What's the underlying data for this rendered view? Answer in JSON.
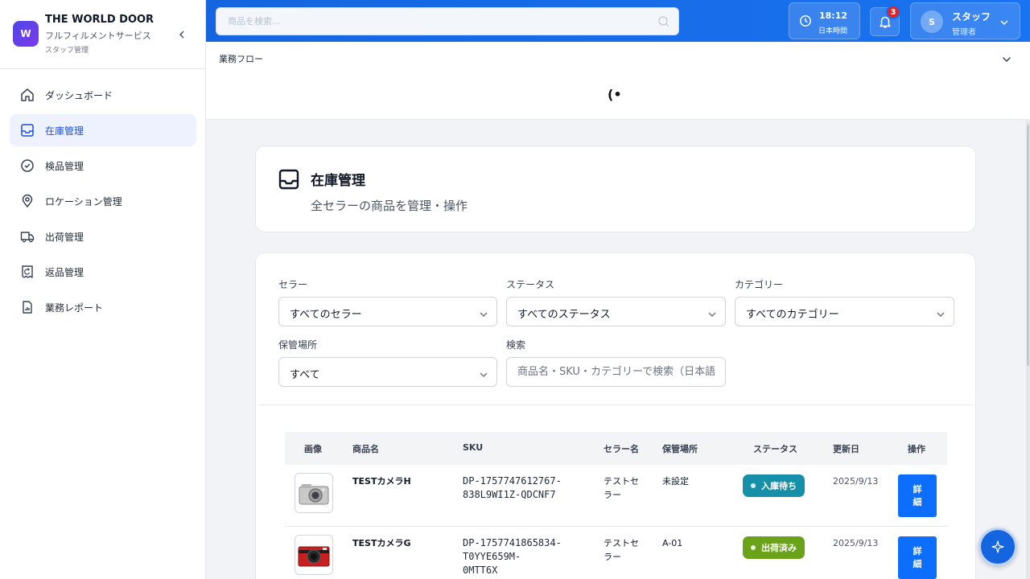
{
  "brand": {
    "logo_letter": "W",
    "title": "THE WORLD DOOR",
    "subtitle": "フルフィルメントサービス",
    "role_label": "スタッフ管理"
  },
  "sidebar": {
    "items": [
      {
        "label": "ダッシュボード",
        "icon": "home-icon",
        "active": false
      },
      {
        "label": "在庫管理",
        "icon": "inbox-icon",
        "active": true
      },
      {
        "label": "検品管理",
        "icon": "check-circle-icon",
        "active": false
      },
      {
        "label": "ロケーション管理",
        "icon": "location-pin-icon",
        "active": false
      },
      {
        "label": "出荷管理",
        "icon": "truck-icon",
        "active": false
      },
      {
        "label": "返品管理",
        "icon": "return-receipt-icon",
        "active": false
      },
      {
        "label": "業務レポート",
        "icon": "report-chart-icon",
        "active": false
      }
    ]
  },
  "topbar": {
    "search_placeholder": "商品を検索...",
    "time": "18:12",
    "timezone_label": "日本時間",
    "notification_count": "3",
    "user": {
      "initial": "S",
      "name": "スタッフ",
      "role": "管理者"
    }
  },
  "workflow": {
    "label": "業務フロー",
    "loading_glyph": "(•"
  },
  "page": {
    "title": "在庫管理",
    "subtitle": "全セラーの商品を管理・操作"
  },
  "filters": {
    "seller": {
      "label": "セラー",
      "value": "すべてのセラー"
    },
    "status": {
      "label": "ステータス",
      "value": "すべてのステータス"
    },
    "category": {
      "label": "カテゴリー",
      "value": "すべてのカテゴリー"
    },
    "location": {
      "label": "保管場所",
      "value": "すべて"
    },
    "search": {
      "label": "検索",
      "placeholder": "商品名・SKU・カテゴリーで検索（日本語"
    }
  },
  "table": {
    "headers": {
      "image": "画像",
      "name": "商品名",
      "sku": "SKU",
      "seller": "セラー名",
      "location": "保管場所",
      "status": "ステータス",
      "updated": "更新日",
      "actions": "操作"
    },
    "rows": [
      {
        "name": "TESTカメラH",
        "sku_lines": [
          "DP-1757747612767-",
          "838L9WI1Z-QDCNF7"
        ],
        "seller_lines": [
          "テストセ",
          "ラー"
        ],
        "location": "未設定",
        "status": "入庫待ち",
        "status_color": "#1590a8",
        "updated": "2025/9/13",
        "action_lines": [
          "詳",
          "細"
        ],
        "thumb_icon": "silver-camera-thumbnail"
      },
      {
        "name": "TESTカメラG",
        "sku_lines": [
          "DP-1757741865834-",
          "T0YYE659M-",
          "0MTT6X"
        ],
        "seller_lines": [
          "テストセ",
          "ラー"
        ],
        "location": "A-01",
        "status": "出荷済み",
        "status_color": "#6aa31a",
        "updated": "2025/9/13",
        "action_lines": [
          "詳",
          "細"
        ],
        "thumb_icon": "red-camera-thumbnail"
      }
    ]
  },
  "colors": {
    "primary": "#1565e0",
    "active_nav_bg": "#eef2ff",
    "active_nav_text": "#1d4ed8",
    "badge_waiting": "#1590a8",
    "badge_shipped": "#6aa31a",
    "detail_button": "#0d6efd"
  }
}
